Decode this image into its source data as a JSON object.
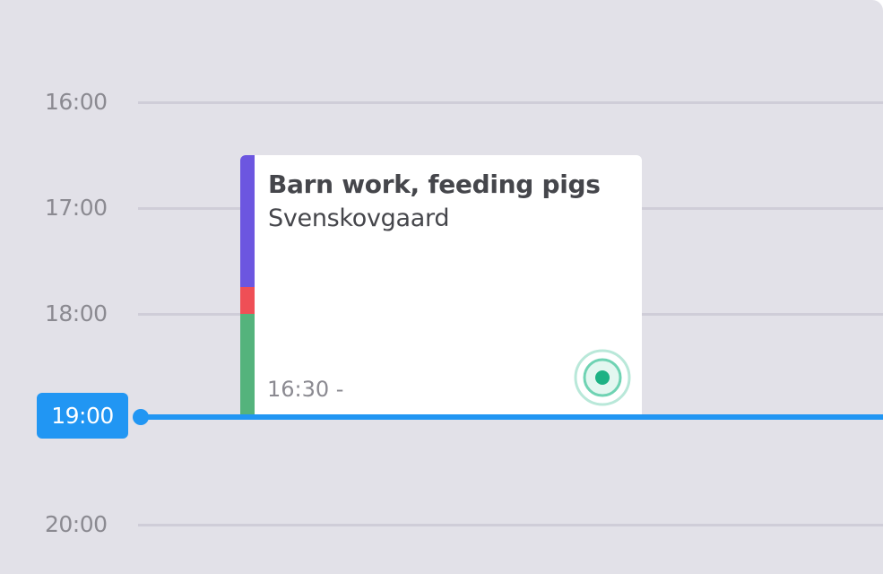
{
  "timeline": {
    "hours": [
      "16:00",
      "17:00",
      "18:00",
      "20:00"
    ]
  },
  "event": {
    "title": "Barn work, feeding pigs",
    "location": "Svenskovgaard",
    "time": "16:30 -",
    "status_icon": "location-target-icon",
    "stripe_colors": [
      "#6c56e0",
      "#ef4f56",
      "#54b37c"
    ]
  },
  "now_indicator": {
    "time": "19:00",
    "color": "#2196f3"
  },
  "colors": {
    "background": "#e2e1e8",
    "grid_line": "#cfcdd8",
    "hour_text": "#8b8a91",
    "card": "#ffffff",
    "title_text": "#45464b",
    "status_green": "#1db284"
  }
}
